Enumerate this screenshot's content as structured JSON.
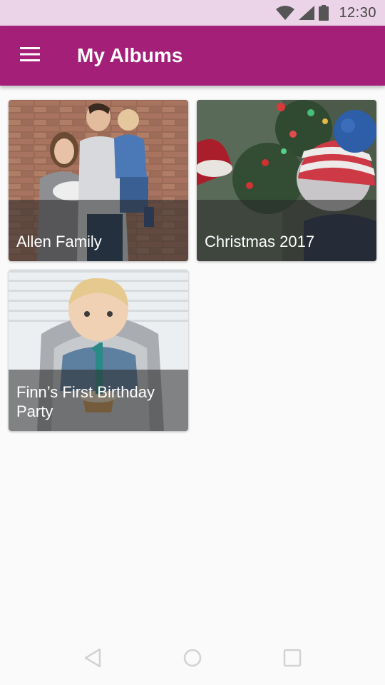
{
  "status_bar": {
    "time": "12:30",
    "icons": [
      "wifi-icon",
      "cellular-signal-icon",
      "battery-icon"
    ]
  },
  "app_bar": {
    "title": "My Albums",
    "menu_icon": "hamburger-menu-icon",
    "color": "#a31f78"
  },
  "albums": [
    {
      "title": "Allen Family"
    },
    {
      "title": "Christmas 2017"
    },
    {
      "title": "Finn’s First Birthday Party"
    }
  ],
  "nav_bar": {
    "buttons": [
      "back-icon",
      "home-icon",
      "recents-icon"
    ]
  },
  "colors": {
    "accent": "#a31f78",
    "status_bar": "#ecd4e8",
    "background": "#fafafa"
  }
}
